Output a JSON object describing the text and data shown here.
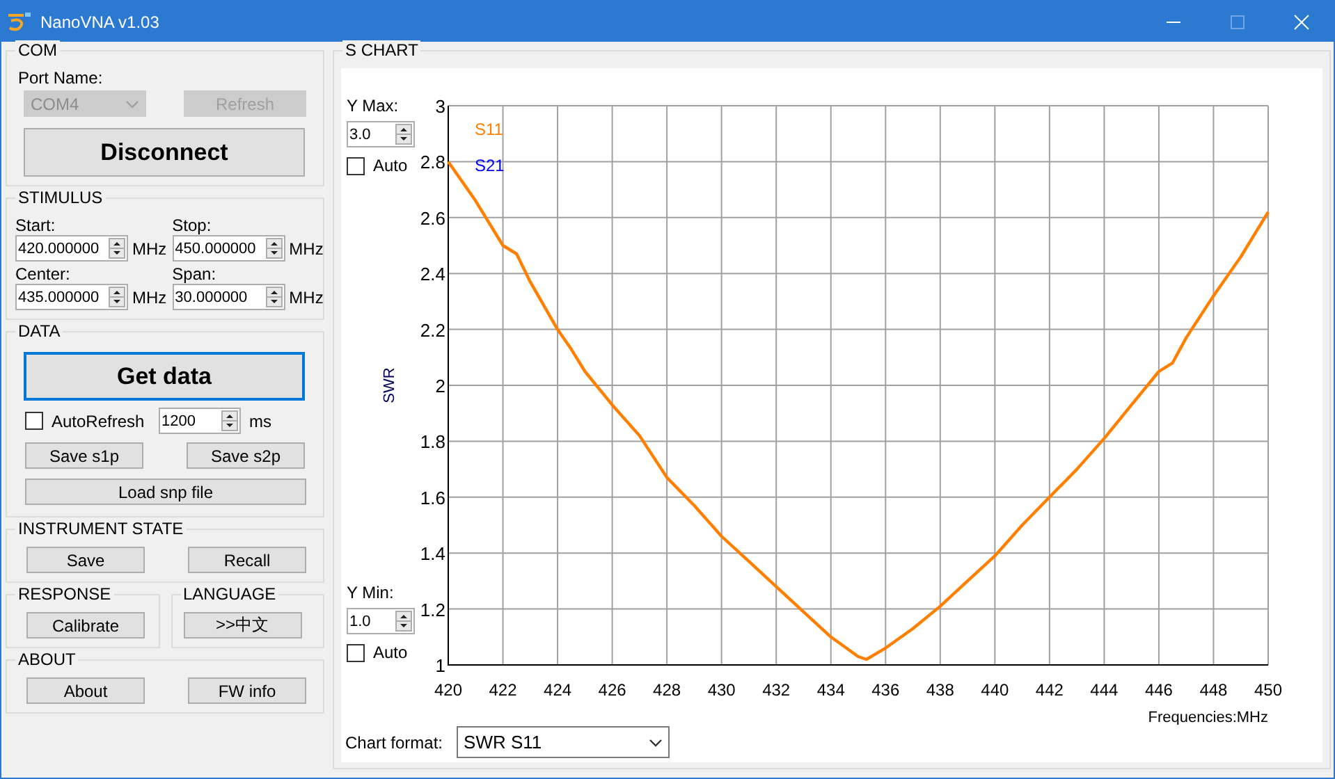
{
  "window": {
    "title": "NanoVNA v1.03"
  },
  "com": {
    "title": "COM",
    "port_label": "Port Name:",
    "port": {
      "value": "COM4",
      "disabled": true
    },
    "refresh": {
      "label": "Refresh",
      "disabled": true
    },
    "connect_button": "Disconnect"
  },
  "stimulus": {
    "title": "STIMULUS",
    "fields": [
      {
        "label": "Start:",
        "value": "420.000000",
        "unit": "MHz"
      },
      {
        "label": "Stop:",
        "value": "450.000000",
        "unit": "MHz"
      },
      {
        "label": "Center:",
        "value": "435.000000",
        "unit": "MHz"
      },
      {
        "label": "Span:",
        "value": "30.000000",
        "unit": "MHz"
      }
    ]
  },
  "data": {
    "title": "DATA",
    "get_data": {
      "label": "Get data",
      "focused": true
    },
    "autorefresh": {
      "label": "AutoRefresh",
      "checked": false
    },
    "interval": {
      "value": "1200",
      "unit": "ms"
    },
    "save_buttons": [
      "Save s1p",
      "Save s2p"
    ],
    "load_button": "Load snp file"
  },
  "instrument_state": {
    "title": "INSTRUMENT STATE",
    "buttons": [
      "Save",
      "Recall"
    ]
  },
  "response": {
    "title": "RESPONSE",
    "button": "Calibrate"
  },
  "language": {
    "title": "LANGUAGE",
    "button": ">>中文"
  },
  "about": {
    "title": "ABOUT",
    "buttons": [
      "About",
      "FW info"
    ]
  },
  "chart_panel": {
    "title": "S CHART",
    "y_max": {
      "label": "Y Max:",
      "value": "3.0",
      "auto": {
        "label": "Auto",
        "checked": false
      }
    },
    "y_min": {
      "label": "Y Min:",
      "value": "1.0",
      "auto": {
        "label": "Auto",
        "checked": false
      }
    },
    "chart_format": {
      "label": "Chart format:",
      "value": "SWR S11"
    },
    "chart_data": {
      "type": "line",
      "grid": true,
      "xlabel": "Frequencies:MHz",
      "ylabel": "SWR",
      "x": [
        420,
        421,
        422,
        422.5,
        423,
        424,
        424.5,
        425,
        426,
        427,
        428,
        429,
        430,
        431,
        432,
        433,
        434,
        435,
        435.3,
        436,
        437,
        438,
        439,
        440,
        441,
        442,
        443,
        444,
        445,
        446,
        446.5,
        447,
        448,
        449,
        450
      ],
      "series": [
        {
          "name": "S11",
          "color": "#ff8000",
          "values": [
            2.8,
            2.66,
            2.5,
            2.47,
            2.37,
            2.2,
            2.13,
            2.05,
            1.93,
            1.82,
            1.67,
            1.57,
            1.46,
            1.37,
            1.28,
            1.19,
            1.1,
            1.03,
            1.02,
            1.06,
            1.13,
            1.21,
            1.3,
            1.39,
            1.5,
            1.6,
            1.7,
            1.81,
            1.93,
            2.05,
            2.08,
            2.17,
            2.32,
            2.46,
            2.62
          ]
        },
        {
          "name": "S21",
          "color": "#0000ff",
          "values": [
            null,
            null,
            null,
            null,
            null,
            null,
            null,
            null,
            null,
            null,
            null,
            null,
            null,
            null,
            null,
            null,
            null,
            null,
            null,
            null,
            null,
            null,
            null,
            null,
            null,
            null,
            null,
            null,
            null,
            null,
            null,
            null,
            null,
            null,
            null
          ]
        }
      ],
      "xlim": [
        420,
        450
      ],
      "ylim": [
        1,
        3
      ],
      "xticks": [
        420,
        422,
        424,
        426,
        428,
        430,
        432,
        434,
        436,
        438,
        440,
        442,
        444,
        446,
        448,
        450
      ],
      "yticks": [
        1,
        1.2,
        1.4,
        1.6,
        1.8,
        2,
        2.2,
        2.4,
        2.6,
        2.8,
        3
      ]
    }
  }
}
